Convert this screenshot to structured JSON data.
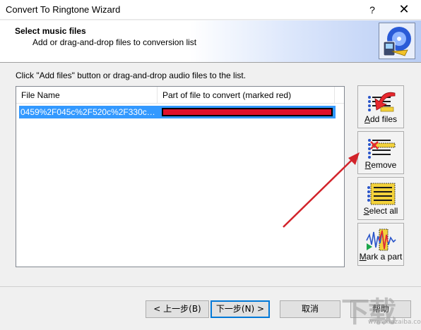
{
  "window": {
    "title": "Convert To Ringtone Wizard",
    "help_glyph": "?",
    "close_glyph": "✕"
  },
  "header": {
    "title": "Select music files",
    "subtitle": "Add or drag-and-drop files to conversion list",
    "logo_icon": "ringtone-logo-icon"
  },
  "instruction": "Click \"Add files\" button or drag-and-drop audio files to the list.",
  "list": {
    "columns": [
      "File Name",
      "Part of file to convert (marked red)"
    ],
    "rows": [
      {
        "file_name": "0459%2F045c%2F520c%2F330c359...",
        "selected": true,
        "part_fraction": 1.0
      }
    ]
  },
  "side_buttons": [
    {
      "key": "A",
      "rest": "dd files",
      "icon": "add-files-icon"
    },
    {
      "key": "R",
      "rest": "emove",
      "icon": "remove-icon"
    },
    {
      "key": "S",
      "rest": "elect all",
      "icon": "select-all-icon"
    },
    {
      "key": "M",
      "rest": "ark a part",
      "icon": "mark-part-icon"
    }
  ],
  "footer": {
    "back_label": "< 上一步(B)",
    "next_label": "下一步(N) >",
    "cancel_label": "取消",
    "help_label": "帮助"
  },
  "watermark": {
    "big": "下载",
    "url": "www.xiazaiba.com"
  },
  "colors": {
    "selection": "#3399ff",
    "part_marked": "#e0102a",
    "annotation_arrow": "#d2232a"
  }
}
